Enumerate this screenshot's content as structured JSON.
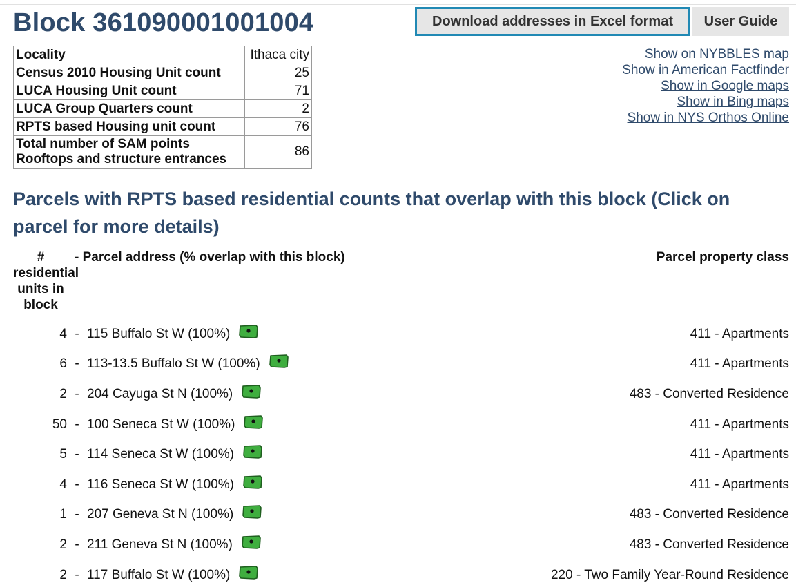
{
  "header": {
    "title": "Block 361090001001004",
    "download_button": "Download addresses in Excel format",
    "guide_button": "User Guide"
  },
  "summary": [
    {
      "label": "Locality",
      "value": "Ithaca city"
    },
    {
      "label": "Census 2010 Housing Unit count",
      "value": "25"
    },
    {
      "label": "LUCA Housing Unit count",
      "value": "71"
    },
    {
      "label": "LUCA Group Quarters count",
      "value": "2"
    },
    {
      "label": "RPTS based Housing unit count",
      "value": "76"
    },
    {
      "label_line1": "Total number of SAM points",
      "label_line2": "Rooftops and structure entrances",
      "value": "86"
    }
  ],
  "links": [
    "Show on NYBBLES map",
    "Show in American Factfinder",
    "Show in Google maps",
    "Show in Bing maps",
    "Show in NYS Orthos Online"
  ],
  "section": {
    "heading": "Parcels with RPTS based residential counts that overlap with this block (Click on parcel for more details)",
    "col_units": [
      "#",
      "residential",
      "units in",
      "block"
    ],
    "col_address": "- Parcel address (% overlap with this block)",
    "col_class": "Parcel property class"
  },
  "parcels": [
    {
      "units": "4",
      "address": "115 Buffalo St W (100%)",
      "class": "411 - Apartments"
    },
    {
      "units": "6",
      "address": "113-13.5 Buffalo St W (100%)",
      "class": "411 - Apartments"
    },
    {
      "units": "2",
      "address": "204 Cayuga St N (100%)",
      "class": "483 - Converted Residence"
    },
    {
      "units": "50",
      "address": "100 Seneca St W (100%)",
      "class": "411 - Apartments"
    },
    {
      "units": "5",
      "address": "114 Seneca St W (100%)",
      "class": "411 - Apartments"
    },
    {
      "units": "4",
      "address": "116 Seneca St W (100%)",
      "class": "411 - Apartments"
    },
    {
      "units": "1",
      "address": "207 Geneva St N (100%)",
      "class": "483 - Converted Residence"
    },
    {
      "units": "2",
      "address": "211 Geneva St N (100%)",
      "class": "483 - Converted Residence"
    },
    {
      "units": "2",
      "address": "117 Buffalo St W (100%)",
      "class": "220 - Two Family Year-Round Residence"
    }
  ],
  "dash": "-",
  "icons": {
    "parcel": "parcel-map-icon",
    "parcel_fill": "#3fae3f",
    "parcel_stroke": "#1f5f1f"
  },
  "colors": {
    "heading": "#2f4a6b",
    "button_border": "#2189b4",
    "button_bg": "#e6e6e6"
  }
}
